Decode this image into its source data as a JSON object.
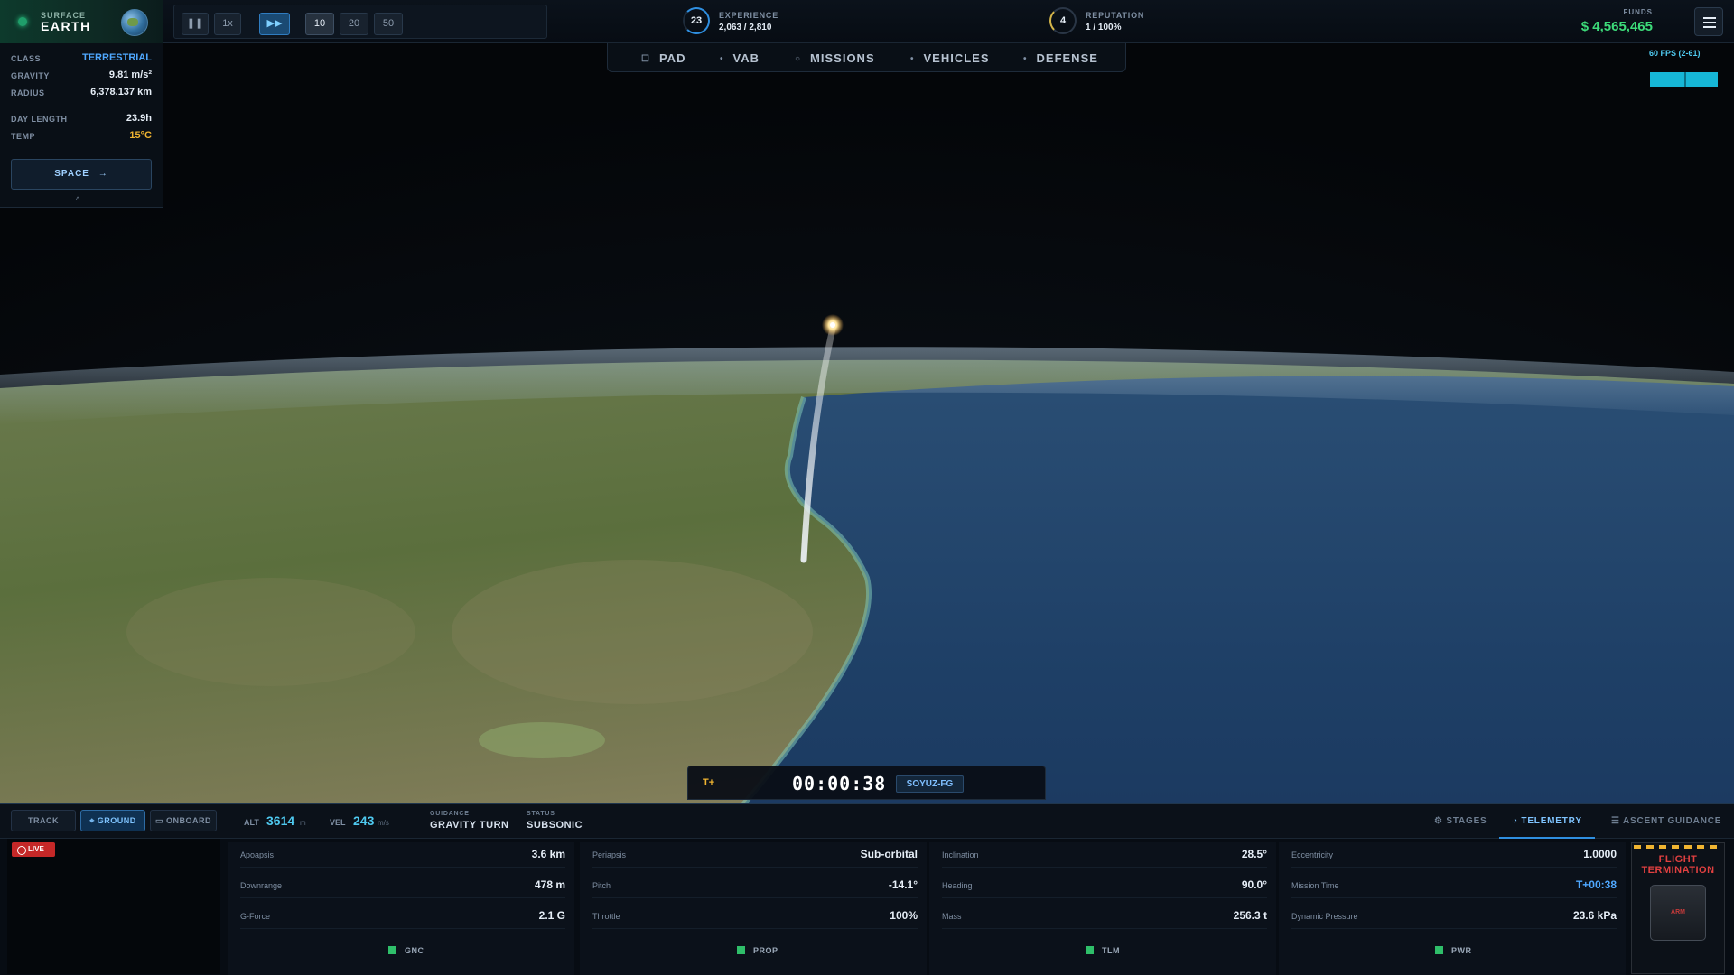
{
  "topbar": {
    "surface_label": "SURFACE",
    "planet_name": "EARTH",
    "speed_controls": [
      "1x",
      "10",
      "20",
      "50"
    ],
    "experience": {
      "level": "23",
      "label": "EXPERIENCE",
      "value": "2,063 / 2,810",
      "progress": 0.73
    },
    "reputation": {
      "level": "4",
      "label": "REPUTATION",
      "value": "1 / 100%",
      "progress": 0.01
    },
    "funds": {
      "label": "FUNDS",
      "value": "$ 4,565,465"
    }
  },
  "nav": {
    "tabs": [
      {
        "label": "PAD",
        "icon": "square-icon"
      },
      {
        "label": "VAB",
        "icon": "dot-icon"
      },
      {
        "label": "MISSIONS",
        "icon": "circle-icon"
      },
      {
        "label": "VEHICLES",
        "icon": "dot-icon"
      },
      {
        "label": "DEFENSE",
        "icon": "dot-icon"
      }
    ]
  },
  "fps": {
    "label": "60 FPS (2-61)"
  },
  "planet_info": {
    "class_label": "CLASS",
    "class_value": "TERRESTRIAL",
    "gravity_label": "GRAVITY",
    "gravity_value": "9.81 m/s²",
    "radius_label": "RADIUS",
    "radius_value": "6,378.137 km",
    "day_label": "DAY LENGTH",
    "day_value": "23.9h",
    "temp_label": "TEMP",
    "temp_value": "15°C",
    "space_button": "SPACE",
    "space_arrow": "→",
    "collapse": "^"
  },
  "clock": {
    "prefix": "T+",
    "time": "00:00:38",
    "vehicle": "SOYUZ-FG"
  },
  "bottom": {
    "camera_tabs": [
      "TRACK",
      "GROUND",
      "ONBOARD"
    ],
    "alt_label": "ALT",
    "alt_value": "3614",
    "alt_unit": "m",
    "vel_label": "VEL",
    "vel_value": "243",
    "vel_unit": "m/s",
    "guidance_label": "GUIDANCE",
    "guidance_value": "GRAVITY TURN",
    "status_label": "STATUS",
    "status_value": "SUBSONIC",
    "right_tabs": [
      "STAGES",
      "TELEMETRY",
      "ASCENT GUIDANCE"
    ],
    "live": "LIVE",
    "telemetry": [
      [
        {
          "k": "Apoapsis",
          "v": "3.6 km"
        },
        {
          "k": "Downrange",
          "v": "478 m"
        },
        {
          "k": "G-Force",
          "v": "2.1 G"
        }
      ],
      [
        {
          "k": "Periapsis",
          "v": "Sub-orbital"
        },
        {
          "k": "Pitch",
          "v": "-14.1°"
        },
        {
          "k": "Throttle",
          "v": "100%"
        }
      ],
      [
        {
          "k": "Inclination",
          "v": "28.5°"
        },
        {
          "k": "Heading",
          "v": "90.0°"
        },
        {
          "k": "Mass",
          "v": "256.3 t"
        }
      ],
      [
        {
          "k": "Eccentricity",
          "v": "1.0000"
        },
        {
          "k": "Mission Time",
          "v": "T+00:38"
        },
        {
          "k": "Dynamic Pressure",
          "v": "23.6 kPa"
        }
      ]
    ],
    "systems": [
      "GNC",
      "PROP",
      "TLM",
      "PWR"
    ],
    "flight_termination": "FLIGHT TERMINATION",
    "arm_label": "ARM"
  },
  "colors": {
    "accent": "#2f8fe0",
    "funds": "#3ddc7a",
    "warning": "#f0b431",
    "danger": "#e04040",
    "ok": "#2fbf6a"
  }
}
